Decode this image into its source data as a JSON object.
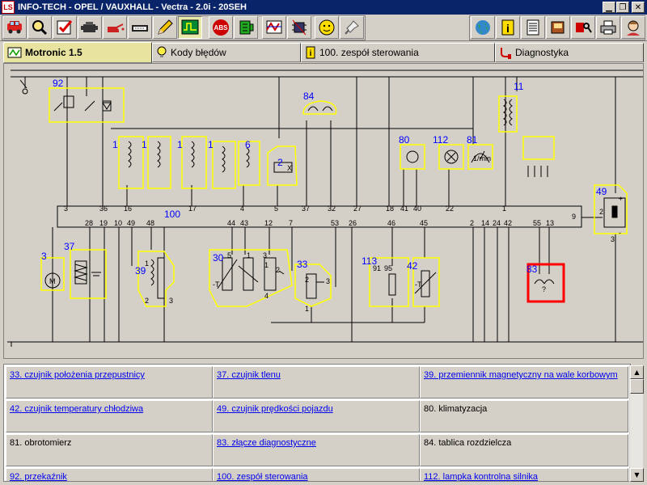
{
  "window": {
    "logo": "LS",
    "title": "INFO-TECH - OPEL / VAUXHALL - Vectra - 2.0i - 20SEH"
  },
  "toolbar": {
    "left_icons": [
      "car-icon",
      "magnifier-icon",
      "checkmark-icon",
      "engine-icon",
      "oil-can-icon",
      "battery-icon",
      "pencil-icon",
      "oscilloscope-icon",
      "abs-icon",
      "connector-icon",
      "timing-icon",
      "chip-icon",
      "gauge-smiley-icon",
      "pin-icon"
    ],
    "right_icons": [
      "globe-icon",
      "info-icon",
      "document-icon",
      "book-icon",
      "key-card-icon",
      "printer-icon",
      "person-icon"
    ]
  },
  "tabs": [
    {
      "label": "Motronic 1.5",
      "icon": "motronic-icon",
      "active": true
    },
    {
      "label": "Kody błędów",
      "icon": "bulb-icon",
      "active": false
    },
    {
      "label": "100. zespół sterowania",
      "icon": "info-icon",
      "active": false
    },
    {
      "label": "Diagnostyka",
      "icon": "diagnostic-plug-icon",
      "active": false
    }
  ],
  "diagram": {
    "components": [
      {
        "id": "92"
      },
      {
        "id": "84"
      },
      {
        "id": "11"
      },
      {
        "id": "1a",
        "label": "1"
      },
      {
        "id": "1b",
        "label": "1"
      },
      {
        "id": "1c",
        "label": "1"
      },
      {
        "id": "1d",
        "label": "1"
      },
      {
        "id": "6"
      },
      {
        "id": "2"
      },
      {
        "id": "80"
      },
      {
        "id": "112"
      },
      {
        "id": "81"
      },
      {
        "id": "49"
      },
      {
        "id": "100"
      },
      {
        "id": "3"
      },
      {
        "id": "37"
      },
      {
        "id": "39"
      },
      {
        "id": "30"
      },
      {
        "id": "33"
      },
      {
        "id": "113"
      },
      {
        "id": "42"
      },
      {
        "id": "83"
      }
    ],
    "pins_top": [
      "3",
      "36",
      "16",
      "17",
      "4",
      "5",
      "37",
      "32",
      "27",
      "18",
      "41",
      "40",
      "22",
      "1"
    ],
    "pins_bottom": [
      "28",
      "19",
      "10",
      "49",
      "48",
      "44",
      "43",
      "12",
      "7",
      "53",
      "26",
      "46",
      "45",
      "2",
      "14",
      "24",
      "42",
      "55",
      "13"
    ],
    "pin_right": "9",
    "misc_labels": {
      "c30": [
        "5",
        "1",
        "3",
        "1",
        "2",
        "4",
        "-T"
      ],
      "c33": [
        "2",
        "3",
        "1"
      ],
      "c113": [
        "91",
        "95"
      ],
      "c42": [
        "-T"
      ],
      "c83": [
        "?"
      ],
      "c39": [
        "1",
        "2",
        "3"
      ],
      "c49": [
        "+",
        "2",
        "3",
        "-"
      ],
      "c81": [
        "1/min"
      ],
      "c2": [
        "X"
      ],
      "c3": [
        "M"
      ]
    },
    "selected_component": "83",
    "colors": {
      "wire": "#000000",
      "outline": "#ffff00",
      "number": "#0000ff",
      "selection": "#ff0000"
    }
  },
  "legend": {
    "rows": [
      [
        {
          "text": "33. czujnik położenia przepustnicy",
          "link": true
        },
        {
          "text": "37. czujnik tlenu",
          "link": true
        },
        {
          "text": "39. przemiennik magnetyczny na wale korbowym",
          "link": true
        }
      ],
      [
        {
          "text": "42. czujnik temperatury chłodziwa",
          "link": true
        },
        {
          "text": "49. czujnik prędkości pojazdu",
          "link": true
        },
        {
          "text": "80. klimatyzacja",
          "link": false
        }
      ],
      [
        {
          "text": "81. obrotomierz",
          "link": false
        },
        {
          "text": "83. złącze diagnostyczne",
          "link": true
        },
        {
          "text": "84. tablica rozdzielcza",
          "link": false
        }
      ],
      [
        {
          "text": "92. przekaźnik",
          "link": true
        },
        {
          "text": "100. zespół sterowania",
          "link": true
        },
        {
          "text": "112. lampka kontrolna silnika",
          "link": true
        }
      ]
    ]
  }
}
